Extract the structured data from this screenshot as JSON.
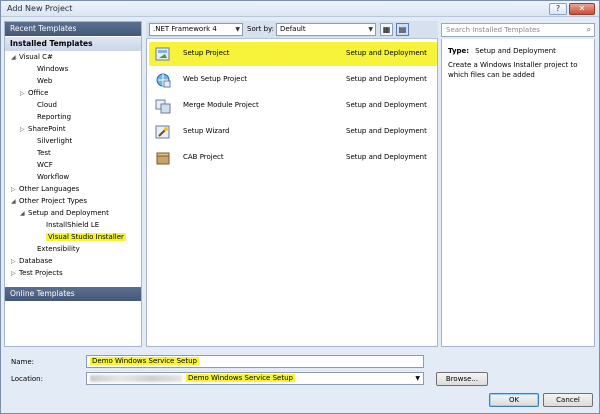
{
  "window": {
    "title": "Add New Project"
  },
  "left_panel": {
    "recent": "Recent Templates",
    "installed": "Installed Templates",
    "online": "Online Templates",
    "tree": [
      {
        "label": "Visual C#",
        "arrow": "◢",
        "indent": 0,
        "hl": false
      },
      {
        "label": "Windows",
        "arrow": "",
        "indent": 2,
        "hl": false
      },
      {
        "label": "Web",
        "arrow": "",
        "indent": 2,
        "hl": false
      },
      {
        "label": "Office",
        "arrow": "▷",
        "indent": 1,
        "hl": false
      },
      {
        "label": "Cloud",
        "arrow": "",
        "indent": 2,
        "hl": false
      },
      {
        "label": "Reporting",
        "arrow": "",
        "indent": 2,
        "hl": false
      },
      {
        "label": "SharePoint",
        "arrow": "▷",
        "indent": 1,
        "hl": false
      },
      {
        "label": "Silverlight",
        "arrow": "",
        "indent": 2,
        "hl": false
      },
      {
        "label": "Test",
        "arrow": "",
        "indent": 2,
        "hl": false
      },
      {
        "label": "WCF",
        "arrow": "",
        "indent": 2,
        "hl": false
      },
      {
        "label": "Workflow",
        "arrow": "",
        "indent": 2,
        "hl": false
      },
      {
        "label": "Other Languages",
        "arrow": "▷",
        "indent": 0,
        "hl": false
      },
      {
        "label": "Other Project Types",
        "arrow": "◢",
        "indent": 0,
        "hl": false
      },
      {
        "label": "Setup and Deployment",
        "arrow": "◢",
        "indent": 1,
        "hl": false
      },
      {
        "label": "InstallShield LE",
        "arrow": "",
        "indent": 3,
        "hl": false
      },
      {
        "label": "Visual Studio Installer",
        "arrow": "",
        "indent": 3,
        "hl": true
      },
      {
        "label": "Extensibility",
        "arrow": "",
        "indent": 2,
        "hl": false
      },
      {
        "label": "Database",
        "arrow": "▷",
        "indent": 0,
        "hl": false
      },
      {
        "label": "Test Projects",
        "arrow": "▷",
        "indent": 0,
        "hl": false
      }
    ]
  },
  "toolbar": {
    "framework": ".NET Framework 4",
    "sort_label": "Sort by:",
    "sort_value": "Default"
  },
  "search": {
    "placeholder": "Search Installed Templates"
  },
  "templates": [
    {
      "name": "Setup Project",
      "category": "Setup and Deployment",
      "icon": "setup-project-icon"
    },
    {
      "name": "Web Setup Project",
      "category": "Setup and Deployment",
      "icon": "web-setup-icon"
    },
    {
      "name": "Merge Module Project",
      "category": "Setup and Deployment",
      "icon": "merge-module-icon"
    },
    {
      "name": "Setup Wizard",
      "category": "Setup and Deployment",
      "icon": "setup-wizard-icon"
    },
    {
      "name": "CAB Project",
      "category": "Setup and Deployment",
      "icon": "cab-project-icon"
    }
  ],
  "details": {
    "type_label": "Type:",
    "type_value": "Setup and Deployment",
    "description": "Create a Windows Installer project to which files can be added"
  },
  "form": {
    "name_label": "Name:",
    "name_value": "Demo Windows Service Setup",
    "location_label": "Location:",
    "location_value": "Demo Windows Service Setup",
    "browse": "Browse...",
    "ok": "OK",
    "cancel": "Cancel"
  },
  "colors": {
    "highlight": "#f6f33a",
    "header": "#44587a"
  }
}
